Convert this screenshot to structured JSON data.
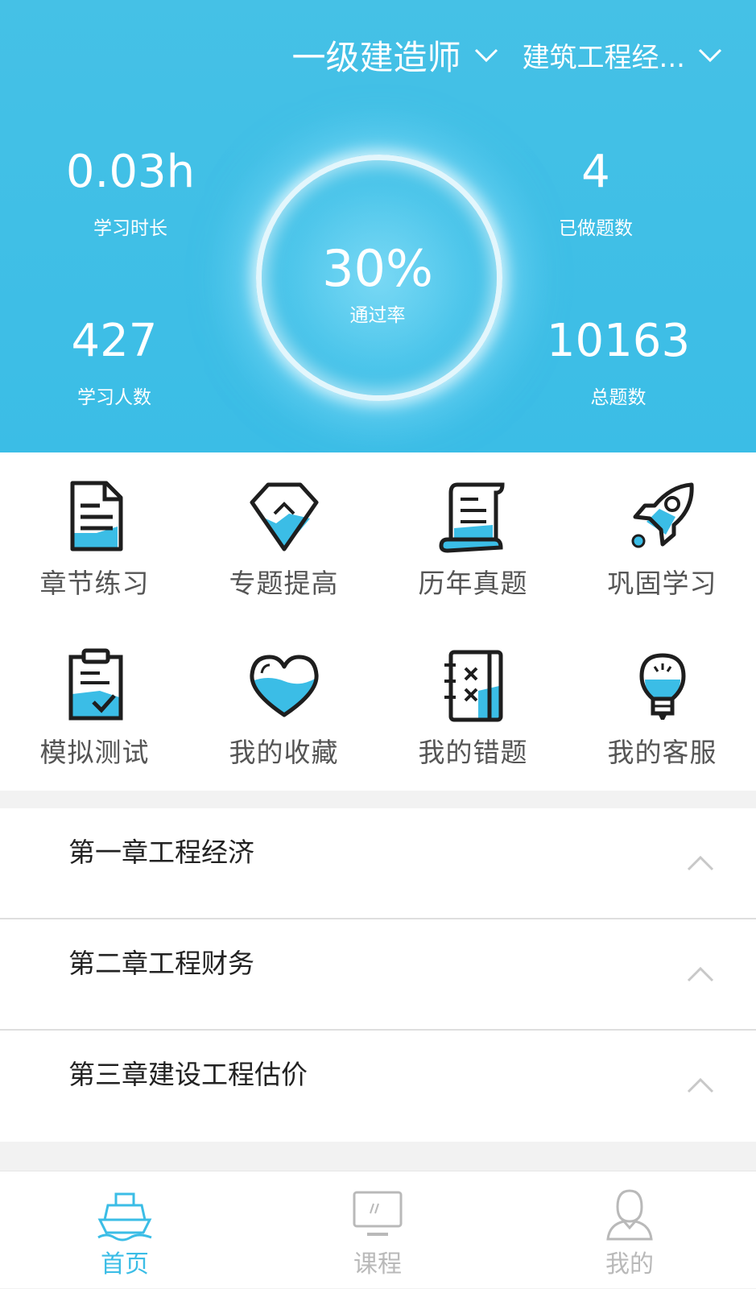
{
  "header": {
    "exam_selector": "一级建造师",
    "subject_selector": "建筑工程经..."
  },
  "stats": {
    "study_time": {
      "value": "0.03h",
      "label": "学习时长"
    },
    "done_questions": {
      "value": "4",
      "label": "已做题数"
    },
    "pass_rate": {
      "value": "30%",
      "label": "通过率"
    },
    "learners": {
      "value": "427",
      "label": "学习人数"
    },
    "total_questions": {
      "value": "10163",
      "label": "总题数"
    }
  },
  "grid": {
    "items": [
      {
        "label": "章节练习",
        "icon": "document-icon"
      },
      {
        "label": "专题提高",
        "icon": "diamond-icon"
      },
      {
        "label": "历年真题",
        "icon": "scroll-icon"
      },
      {
        "label": "巩固学习",
        "icon": "rocket-icon"
      },
      {
        "label": "模拟测试",
        "icon": "clipboard-check-icon"
      },
      {
        "label": "我的收藏",
        "icon": "heart-icon"
      },
      {
        "label": "我的错题",
        "icon": "notebook-x-icon"
      },
      {
        "label": "我的客服",
        "icon": "lightbulb-icon"
      }
    ]
  },
  "chapters": [
    {
      "title": "第一章工程经济"
    },
    {
      "title": "第二章工程财务"
    },
    {
      "title": "第三章建设工程估价"
    }
  ],
  "tabbar": {
    "tabs": [
      {
        "label": "首页",
        "icon": "ship-icon",
        "active": true
      },
      {
        "label": "课程",
        "icon": "monitor-icon",
        "active": false
      },
      {
        "label": "我的",
        "icon": "user-icon",
        "active": false
      }
    ]
  },
  "colors": {
    "primary": "#3bbde6",
    "icon_fill": "#3bbde6",
    "icon_stroke": "#1e1e1e",
    "text_gray": "#555555",
    "tab_inactive": "#b9b9b9"
  }
}
